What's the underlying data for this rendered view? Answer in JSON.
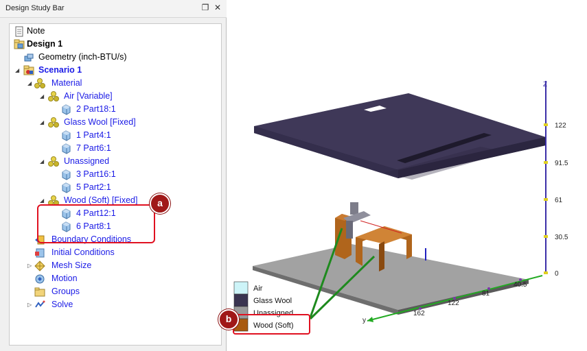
{
  "panel": {
    "title": "Design Study Bar",
    "dock_glyph": "❐",
    "close_glyph": "✕"
  },
  "tree": [
    {
      "id": "note",
      "label": "Note",
      "icon": "note-icon",
      "style": "plain",
      "expander": "",
      "level": 0
    },
    {
      "id": "design",
      "label": "Design 1",
      "icon": "design-icon",
      "style": "bold",
      "expander": "",
      "level": 0
    },
    {
      "id": "geometry",
      "label": "Geometry (inch-BTU/s)",
      "icon": "geometry-icon",
      "style": "plain",
      "expander": "",
      "level": 1
    },
    {
      "id": "scenario",
      "label": "Scenario 1",
      "icon": "scenario-icon",
      "style": "bold-blue",
      "expander": "◢",
      "level": 1
    },
    {
      "id": "material",
      "label": "Material",
      "icon": "material-icon",
      "style": "blue",
      "expander": "◢",
      "level": 2
    },
    {
      "id": "air",
      "label": "Air [Variable]",
      "icon": "material-icon",
      "style": "blue",
      "expander": "◢",
      "level": 3
    },
    {
      "id": "part18",
      "label": "2 Part18:1",
      "icon": "part-icon",
      "style": "blue",
      "expander": "",
      "level": 4
    },
    {
      "id": "glasswool",
      "label": "Glass Wool [Fixed]",
      "icon": "material-icon",
      "style": "blue",
      "expander": "◢",
      "level": 3
    },
    {
      "id": "part4",
      "label": "1 Part4:1",
      "icon": "part-icon",
      "style": "blue",
      "expander": "",
      "level": 4
    },
    {
      "id": "part6",
      "label": "7 Part6:1",
      "icon": "part-icon",
      "style": "blue",
      "expander": "",
      "level": 4
    },
    {
      "id": "unassigned",
      "label": "Unassigned",
      "icon": "material-icon",
      "style": "blue",
      "expander": "◢",
      "level": 3
    },
    {
      "id": "part16",
      "label": "3 Part16:1",
      "icon": "part-icon",
      "style": "blue",
      "expander": "",
      "level": 4
    },
    {
      "id": "part2",
      "label": "5 Part2:1",
      "icon": "part-icon",
      "style": "blue",
      "expander": "",
      "level": 4
    },
    {
      "id": "wood",
      "label": "Wood (Soft) [Fixed]",
      "icon": "material-icon",
      "style": "blue",
      "expander": "◢",
      "level": 3
    },
    {
      "id": "part12",
      "label": "4 Part12:1",
      "icon": "part-icon",
      "style": "blue",
      "expander": "",
      "level": 4
    },
    {
      "id": "part8",
      "label": "6 Part8:1",
      "icon": "part-icon",
      "style": "blue",
      "expander": "",
      "level": 4
    },
    {
      "id": "boundary",
      "label": "Boundary Conditions",
      "icon": "boundary-icon",
      "style": "blue",
      "expander": "",
      "level": 2
    },
    {
      "id": "initial",
      "label": "Initial Conditions",
      "icon": "initial-icon",
      "style": "blue",
      "expander": "",
      "level": 2
    },
    {
      "id": "mesh",
      "label": "Mesh Size",
      "icon": "mesh-icon",
      "style": "blue",
      "expander": "▷",
      "level": 2
    },
    {
      "id": "motion",
      "label": "Motion",
      "icon": "motion-icon",
      "style": "blue",
      "expander": "",
      "level": 2
    },
    {
      "id": "groups",
      "label": "Groups",
      "icon": "groups-icon",
      "style": "blue",
      "expander": "",
      "level": 2
    },
    {
      "id": "solve",
      "label": "Solve",
      "icon": "solve-icon",
      "style": "blue",
      "expander": "▷",
      "level": 2
    }
  ],
  "callouts": {
    "a": "a",
    "b": "b"
  },
  "legend": [
    {
      "label": "Air",
      "color": "#cdf4f8"
    },
    {
      "label": "Glass Wool",
      "color": "#3a3450"
    },
    {
      "label": "Unassigned",
      "color": "#9a9a9a"
    },
    {
      "label": "Wood (Soft)",
      "color": "#a85a10"
    }
  ],
  "axes": {
    "z_label": "Z",
    "y_label": "y",
    "z_ticks": [
      "122",
      "91.5",
      "61",
      "30.5",
      "0"
    ],
    "x_ticks": [
      "40.5",
      "81",
      "122",
      "162"
    ]
  },
  "colors": {
    "accent_blue": "#1a1ae6",
    "callout_red": "#e01020",
    "glass_wool": "#3a3450",
    "wood": "#a85a10",
    "base": "#9a9a9a",
    "z_axis": "#3b2fa8",
    "y_axis": "#22aa22"
  }
}
